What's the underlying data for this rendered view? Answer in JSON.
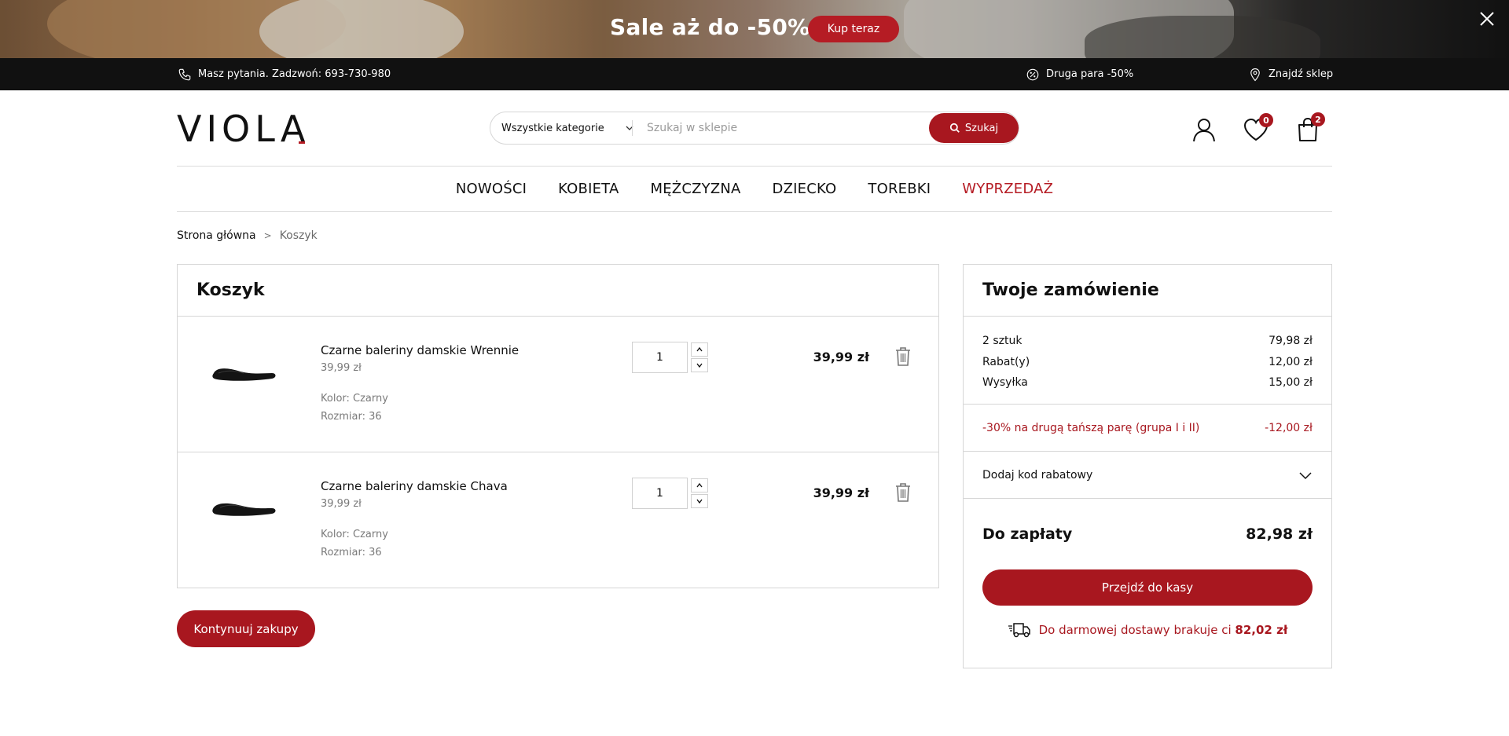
{
  "promo": {
    "title": "Sale aż do -50%",
    "button_label": "Kup teraz"
  },
  "infobar": {
    "phone_text": "Masz pytania. Zadzwoń: 693-730-980",
    "second_pair_text": "Druga para -50%",
    "store_text": "Znajdź sklep"
  },
  "header": {
    "logo_text": "VIOLA",
    "search": {
      "category": "Wszystkie kategorie",
      "placeholder": "Szukaj w sklepie",
      "button_label": "Szukaj"
    },
    "wishlist_count": "0",
    "cart_count": "2"
  },
  "nav": {
    "items": [
      "NOWOŚCI",
      "KOBIETA",
      "MĘŻCZYZNA",
      "DZIECKO",
      "TOREBKI",
      "WYPRZEDAŻ"
    ]
  },
  "breadcrumb": {
    "home": "Strona główna",
    "separator": ">",
    "current": "Koszyk"
  },
  "cart": {
    "title": "Koszyk",
    "items": [
      {
        "name": "Czarne baleriny damskie Wrennie",
        "unit_price": "39,99 zł",
        "color": "Kolor: Czarny",
        "size": "Rozmiar: 36",
        "quantity": "1",
        "total": "39,99 zł"
      },
      {
        "name": "Czarne baleriny damskie Chava",
        "unit_price": "39,99 zł",
        "color": "Kolor: Czarny",
        "size": "Rozmiar: 36",
        "quantity": "1",
        "total": "39,99 zł"
      }
    ],
    "continue_label": "Kontynuuj zakupy"
  },
  "order": {
    "title": "Twoje zamówienie",
    "lines": [
      {
        "label": "2 sztuk",
        "value": "79,98 zł"
      },
      {
        "label": "Rabat(y)",
        "value": "12,00 zł"
      },
      {
        "label": "Wysyłka",
        "value": "15,00 zł"
      }
    ],
    "promo_label": "-30% na drugą tańszą parę (grupa I i II)",
    "promo_value": "-12,00 zł",
    "coupon_label": "Dodaj kod rabatowy",
    "pay_label": "Do zapłaty",
    "pay_value": "82,98 zł",
    "checkout_label": "Przejdź do kasy",
    "free_shipping_text": "Do darmowej dostawy brakuje ci",
    "free_shipping_amount": "82,02 zł"
  },
  "colors": {
    "accent": "#a8171f",
    "dark_bar": "#111111",
    "border": "#d6d6d6"
  }
}
